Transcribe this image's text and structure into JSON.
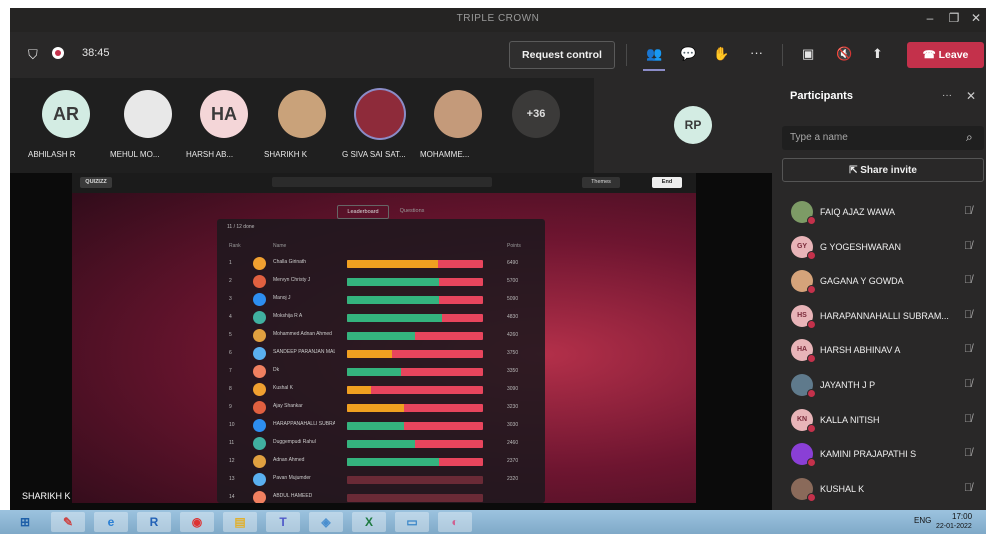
{
  "window": {
    "title": "TRIPLE CROWN"
  },
  "toolbar": {
    "timer": "38:45",
    "request_control_label": "Request control",
    "leave_label": "Leave",
    "more_label": "···"
  },
  "strip": {
    "participants": [
      {
        "initials": "AR",
        "name": "ABHILASH R",
        "color": "#d3ece3",
        "has_photo": false
      },
      {
        "initials": "",
        "name": "MEHUL MO...",
        "color": "#e8e8e8",
        "has_photo": true
      },
      {
        "initials": "HA",
        "name": "HARSH AB...",
        "color": "#f4d6d8",
        "has_photo": false
      },
      {
        "initials": "",
        "name": "SHARIKH K",
        "color": "#c9a27a",
        "has_photo": true
      },
      {
        "initials": "",
        "name": "G SIVA SAI SAT...",
        "color": "#8e2b3a",
        "has_photo": true
      },
      {
        "initials": "",
        "name": "MOHAMME...",
        "color": "#c49a7a",
        "has_photo": true
      }
    ],
    "overflow_count": "+36",
    "rp_initials": "RP"
  },
  "share": {
    "sharer_label": "SHARIKH K",
    "quiz": {
      "brand": "QUIZIZZ",
      "themes_label": "Themes",
      "end_label": "End",
      "tab_leaderboard": "Leaderboard",
      "tab_questions": "Questions",
      "col_rank": "Rank",
      "col_name": "Name",
      "col_points": "Points",
      "panel_count": "11 / 12 done",
      "rows": [
        {
          "rank": "1",
          "name": "Challa Girinath",
          "green": 0.0,
          "orange": 0.67,
          "score": "6490"
        },
        {
          "rank": "2",
          "name": "Mervyn Christy J",
          "green": 0.68,
          "orange": 0.0,
          "score": "5700"
        },
        {
          "rank": "3",
          "name": "Manoj J",
          "green": 0.68,
          "orange": 0.0,
          "score": "5090"
        },
        {
          "rank": "4",
          "name": "Mokshija R A",
          "green": 0.7,
          "orange": 0.0,
          "score": "4830"
        },
        {
          "rank": "5",
          "name": "Mohammed Adnan Ahmed",
          "green": 0.5,
          "orange": 0.0,
          "score": "4260"
        },
        {
          "rank": "6",
          "name": "SANDEEP PARANJAN MALLIT",
          "green": 0.0,
          "orange": 0.33,
          "score": "3750"
        },
        {
          "rank": "7",
          "name": "Dk",
          "green": 0.4,
          "orange": 0.0,
          "score": "3350"
        },
        {
          "rank": "8",
          "name": "Kushal K",
          "green": 0.0,
          "orange": 0.18,
          "score": "3090"
        },
        {
          "rank": "9",
          "name": "Ajay Shankar",
          "green": 0.0,
          "orange": 0.42,
          "score": "3230"
        },
        {
          "rank": "10",
          "name": "HARAPPANAHALLI SUBRAMANYA",
          "green": 0.42,
          "orange": 0.0,
          "score": "3030"
        },
        {
          "rank": "11",
          "name": "Duggempudi Rahul",
          "green": 0.5,
          "orange": 0.0,
          "score": "2460"
        },
        {
          "rank": "12",
          "name": "Adnan Ahmed",
          "green": 0.68,
          "orange": 0.0,
          "score": "2370"
        },
        {
          "rank": "13",
          "name": "Pavan Mujumder",
          "green": 0.0,
          "orange": 0.0,
          "score": "2320"
        },
        {
          "rank": "14",
          "name": "ABDUL HAMEED",
          "green": 0.0,
          "orange": 0.0,
          "score": ""
        }
      ]
    }
  },
  "sidebar": {
    "title": "Participants",
    "search_placeholder": "Type a name",
    "share_invite_label": "Share invite",
    "people": [
      {
        "initials": "",
        "name": "FAIQ AJAZ WAWA",
        "color": "#7d9b66"
      },
      {
        "initials": "GY",
        "name": "G YOGESHWARAN",
        "color": "#e8b4b8"
      },
      {
        "initials": "",
        "name": "GAGANA Y GOWDA",
        "color": "#d5a37a"
      },
      {
        "initials": "HS",
        "name": "HARAPANNAHALLI SUBRAM...",
        "color": "#e8b4b8"
      },
      {
        "initials": "HA",
        "name": "HARSH ABHINAV A",
        "color": "#e8b4b8"
      },
      {
        "initials": "",
        "name": "JAYANTH J P",
        "color": "#5f7a8c"
      },
      {
        "initials": "KN",
        "name": "KALLA NITISH",
        "color": "#e8b4b8"
      },
      {
        "initials": "",
        "name": "KAMINI PRAJAPATHI S",
        "color": "#8a3fd6"
      },
      {
        "initials": "",
        "name": "KUSHAL K",
        "color": "#8a6a5a"
      }
    ]
  },
  "taskbar": {
    "apps": [
      {
        "label": "⊞",
        "name": "start",
        "color": "#1e5fa8"
      },
      {
        "label": "✎",
        "name": "paint",
        "color": "#c44"
      },
      {
        "label": "e",
        "name": "ie",
        "color": "#2a7fd4"
      },
      {
        "label": "R",
        "name": "r",
        "color": "#2462b6"
      },
      {
        "label": "◉",
        "name": "chrome",
        "color": "#d33"
      },
      {
        "label": "▤",
        "name": "explorer",
        "color": "#e0b030"
      },
      {
        "label": "T",
        "name": "teams",
        "color": "#5059c9"
      },
      {
        "label": "◈",
        "name": "app7",
        "color": "#4a8fcf"
      },
      {
        "label": "X",
        "name": "excel",
        "color": "#1d7a40"
      },
      {
        "label": "▭",
        "name": "app9",
        "color": "#3a86c8"
      },
      {
        "label": "◐",
        "name": "app10",
        "color": "#d06090"
      }
    ],
    "lang": "ENG",
    "time": "17:00",
    "date": "22-01-2022"
  }
}
